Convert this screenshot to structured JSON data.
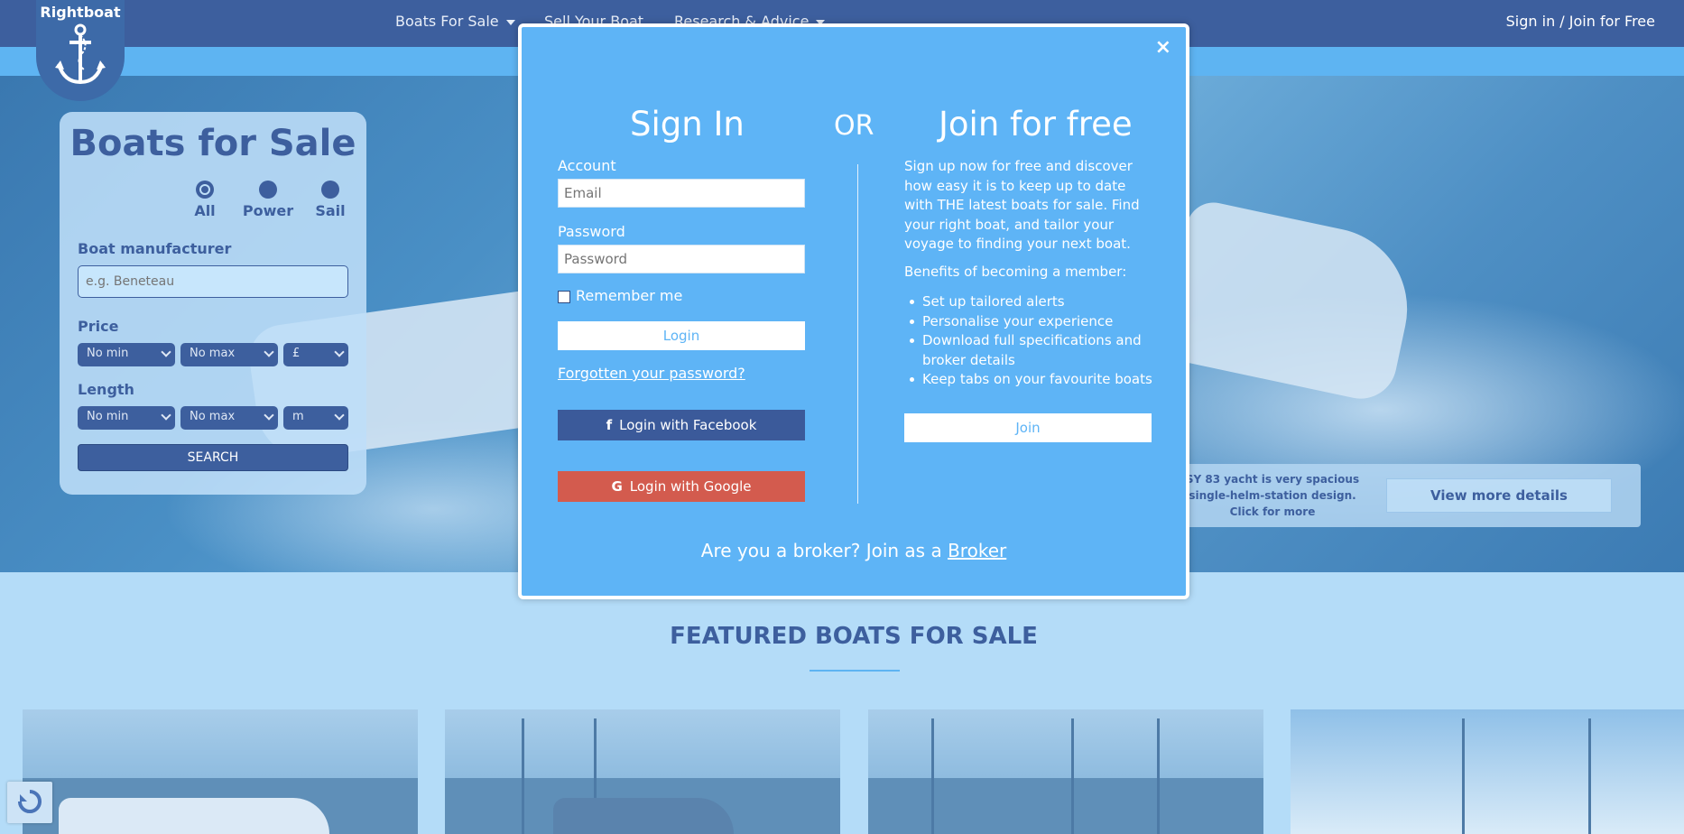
{
  "header": {
    "logo_text": "Rightboat",
    "nav": [
      {
        "label": "Boats For Sale"
      },
      {
        "label": "Sell Your Boat"
      },
      {
        "label": "Research & Advice"
      }
    ],
    "signin_label": "Sign in / Join for Free"
  },
  "search": {
    "title": "Boats for Sale",
    "types": [
      "All",
      "Power",
      "Sail"
    ],
    "selected_type": "All",
    "manufacturer_label": "Boat manufacturer",
    "manufacturer_placeholder": "e.g. Beneteau",
    "price_label": "Price",
    "price_min": "No min",
    "price_max": "No max",
    "currency": "£",
    "length_label": "Length",
    "length_min": "No min",
    "length_max": "No max",
    "length_unit": "m",
    "search_label": "SEARCH"
  },
  "hero": {
    "caption_line1": "SY 83 yacht is very spacious",
    "caption_line2": "single-helm-station design.",
    "caption_line3": "Click for more",
    "view_more_label": "View more details"
  },
  "featured": {
    "title": "FEATURED BOATS FOR SALE"
  },
  "modal": {
    "close_label": "×",
    "signin_title": "Sign In",
    "or_label": "OR",
    "join_title": "Join for free",
    "account_label": "Account",
    "email_placeholder": "Email",
    "password_label": "Password",
    "password_placeholder": "Password",
    "remember_label": "Remember me",
    "login_label": "Login",
    "forgot_label": "Forgotten your password?",
    "facebook_label": "Login with Facebook",
    "google_label": "Login with Google",
    "join_text": "Sign up now for free and discover how easy it is to keep up to date with THE latest boats for sale. Find your right boat, and tailor your voyage to finding your next boat.",
    "benefits_title": "Benefits of becoming a member:",
    "benefits": [
      "Set up tailored alerts",
      "Personalise your experience",
      "Download full specifications and broker details",
      "Keep tabs on your favourite boats"
    ],
    "join_label": "Join",
    "broker_prefix": "Are you a broker? Join as a",
    "broker_link": "Broker"
  },
  "colors": {
    "navy": "#3d5f9e",
    "modal_blue": "#5eb4f6",
    "facebook": "#3b5a9a",
    "google": "#d35b4e"
  },
  "icons": [
    "anchor-icon",
    "caret-down-icon",
    "close-icon",
    "facebook-icon",
    "google-icon",
    "recaptcha-icon"
  ]
}
